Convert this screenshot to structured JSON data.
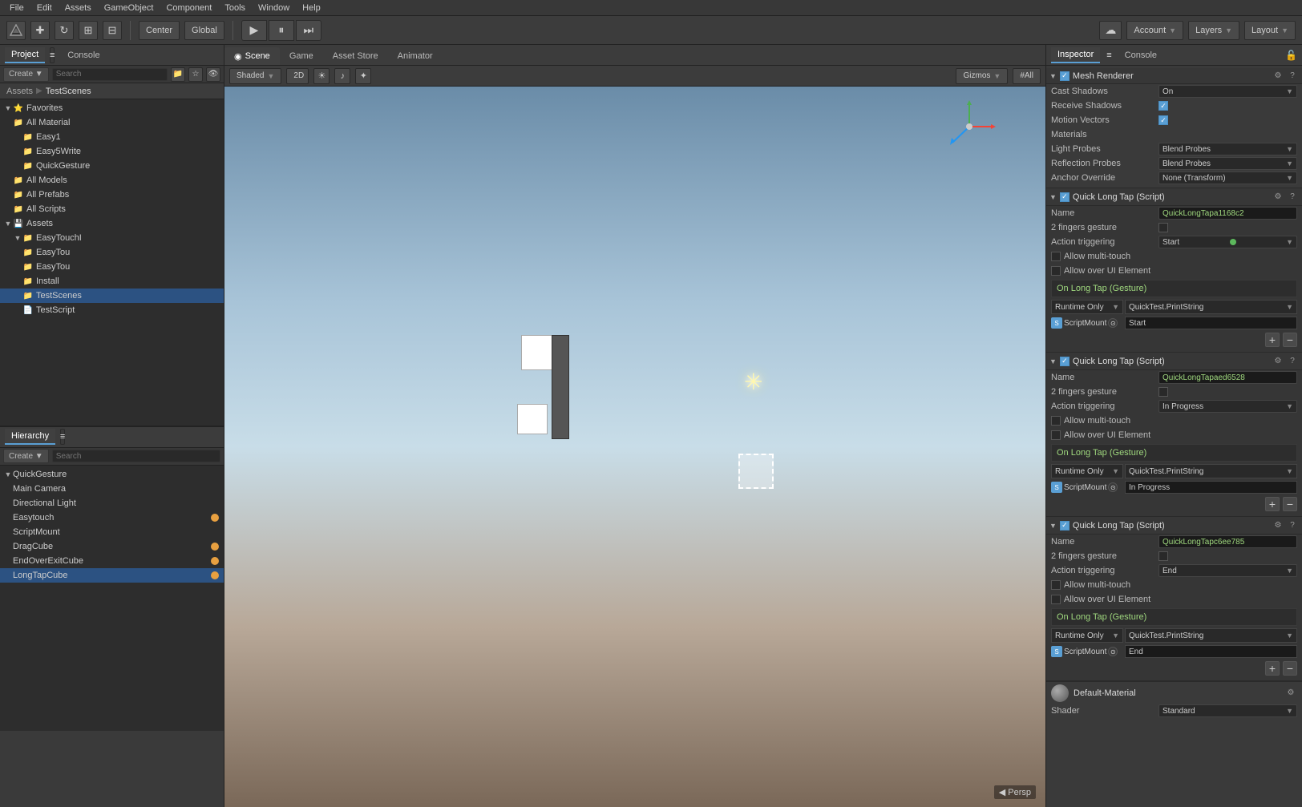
{
  "menubar": {
    "items": [
      "File",
      "Edit",
      "Assets",
      "GameObject",
      "Component",
      "Tools",
      "Window",
      "Help"
    ]
  },
  "toolbar": {
    "transform_btns": [
      "⊕",
      "✥",
      "↺",
      "⤢",
      "⊡"
    ],
    "pivot_btn": "Center",
    "space_btn": "Global",
    "play_btns": [
      "▶",
      "⏸",
      "⏭"
    ],
    "cloud_icon": "☁",
    "account_label": "Account",
    "layers_label": "Layers",
    "layout_label": "Layout"
  },
  "project_panel": {
    "tabs": [
      "Project",
      "Console"
    ],
    "breadcrumb": [
      "Assets",
      "TestScenes"
    ],
    "search_placeholder": "Search",
    "favorites": {
      "label": "Favorites",
      "items": [
        {
          "name": "All Material",
          "icon": "folder"
        },
        {
          "name": "Easy1",
          "icon": "folder",
          "indent": 1
        },
        {
          "name": "Easy5Write",
          "icon": "folder",
          "indent": 1
        },
        {
          "name": "QuickGesture",
          "icon": "folder",
          "indent": 1
        },
        {
          "name": "All Models",
          "icon": "folder"
        },
        {
          "name": "All Prefabs",
          "icon": "folder"
        },
        {
          "name": "All Scripts",
          "icon": "folder"
        }
      ]
    },
    "assets": {
      "label": "Assets",
      "items": [
        {
          "name": "EasyTouch!",
          "icon": "folder",
          "indent": 1
        },
        {
          "name": "EasyTou",
          "icon": "folder",
          "indent": 2
        },
        {
          "name": "EasyTou",
          "icon": "folder",
          "indent": 2
        },
        {
          "name": "Install",
          "icon": "folder",
          "indent": 2
        },
        {
          "name": "TestScenes",
          "icon": "folder",
          "indent": 2,
          "selected": true
        },
        {
          "name": "TestScript",
          "icon": "script",
          "indent": 2
        }
      ]
    }
  },
  "hierarchy_panel": {
    "title": "Hierarchy",
    "items": [
      {
        "name": "QuickGesture",
        "indent": 0,
        "bold": true
      },
      {
        "name": "Main Camera",
        "indent": 1
      },
      {
        "name": "Directional Light",
        "indent": 1
      },
      {
        "name": "Easytouch",
        "indent": 1,
        "badge": "orange"
      },
      {
        "name": "ScriptMount",
        "indent": 1
      },
      {
        "name": "DragCube",
        "indent": 1,
        "badge": "orange"
      },
      {
        "name": "EndOverExitCube",
        "indent": 1,
        "badge": "orange"
      },
      {
        "name": "LongTapCube",
        "indent": 1,
        "selected": true,
        "badge": "orange"
      }
    ]
  },
  "scene_tabs": [
    {
      "label": "Scene",
      "icon": "◉",
      "active": true
    },
    {
      "label": "Game",
      "icon": "🎮"
    },
    {
      "label": "Asset Store",
      "icon": "🛒"
    },
    {
      "label": "Animator",
      "icon": "⊞"
    }
  ],
  "scene_toolbar": {
    "shaded_label": "Shaded",
    "twod_btn": "2D",
    "gizmos_btn": "Gizmos",
    "all_btn": "#All"
  },
  "inspector": {
    "tabs": [
      "Inspector",
      "Console"
    ],
    "mesh_renderer": {
      "title": "Mesh Renderer",
      "cast_shadows": "On",
      "receive_shadows": true,
      "motion_vectors": true,
      "materials_label": "Materials",
      "light_probes": "Blend Probes",
      "reflection_probes": "Blend Probes",
      "anchor_override": "None (Transform)"
    },
    "components": [
      {
        "id": 1,
        "title": "Quick Long Tap (Script)",
        "name_value": "QuickLongTapa1168c2",
        "two_fingers": false,
        "action_triggering": "Start",
        "allow_multi_touch": false,
        "allow_over_ui": false,
        "gesture_event": "On Long Tap (Gesture)",
        "runtime_only": "Runtime Only",
        "function": "QuickTest.PrintString",
        "mount_object": "ScriptMount",
        "mount_value": "Start",
        "add_remove": true
      },
      {
        "id": 2,
        "title": "Quick Long Tap (Script)",
        "name_value": "QuickLongTapaed6528",
        "two_fingers": false,
        "action_triggering": "In Progress",
        "allow_multi_touch": false,
        "allow_over_ui": false,
        "gesture_event": "On Long Tap (Gesture)",
        "runtime_only": "Runtime Only",
        "function": "QuickTest.PrintString",
        "mount_object": "ScriptMount",
        "mount_value": "In Progress",
        "add_remove": true
      },
      {
        "id": 3,
        "title": "Quick Long Tap (Script)",
        "name_value": "QuickLongTapc6ee785",
        "two_fingers": false,
        "action_triggering": "End",
        "allow_multi_touch": false,
        "allow_over_ui": false,
        "gesture_event": "On Long Tap (Gesture)",
        "runtime_only": "Runtime Only",
        "function": "QuickTest.PrintString",
        "mount_object": "ScriptMount",
        "mount_value": "End",
        "add_remove": false
      }
    ],
    "default_material": {
      "label": "Default-Material",
      "shader": "Shader",
      "shader_value": "Standard"
    }
  }
}
